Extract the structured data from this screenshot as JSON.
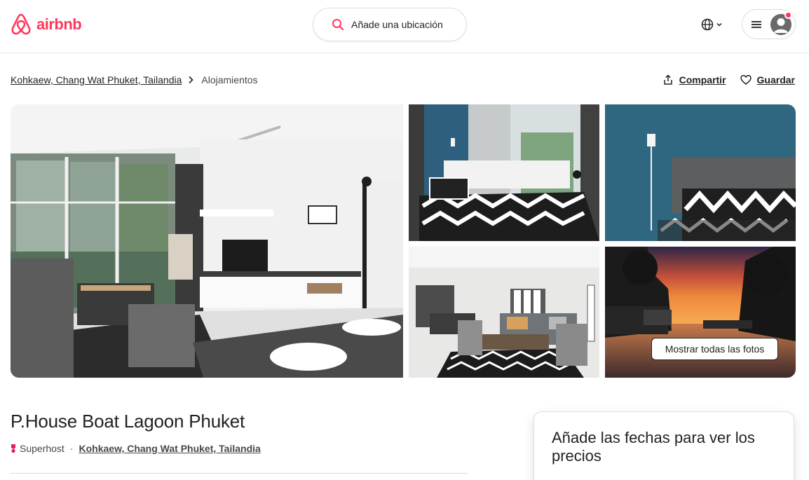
{
  "brand": {
    "name": "airbnb",
    "color": "#ff385c"
  },
  "header": {
    "search_placeholder": "Añade una ubicación",
    "globe_icon": "globe-icon",
    "menu_icon": "hamburger-icon",
    "avatar_icon": "user-avatar-icon"
  },
  "breadcrumb": {
    "location": "Kohkaew, Chang Wat Phuket, Tailandia",
    "current": "Alojamientos"
  },
  "actions": {
    "share_label": "Compartir",
    "save_label": "Guardar"
  },
  "gallery": {
    "show_all_label": "Mostrar todas las fotos",
    "photos": [
      "living-room",
      "bedroom-window",
      "bedroom-headboard",
      "lounge",
      "sunset-lagoon"
    ]
  },
  "listing": {
    "title": "P.House Boat Lagoon Phuket",
    "host_badge": "Superhost",
    "separator": "·",
    "location": "Kohkaew, Chang Wat Phuket, Tailandia"
  },
  "booking": {
    "prompt": "Añade las fechas para ver los precios"
  }
}
